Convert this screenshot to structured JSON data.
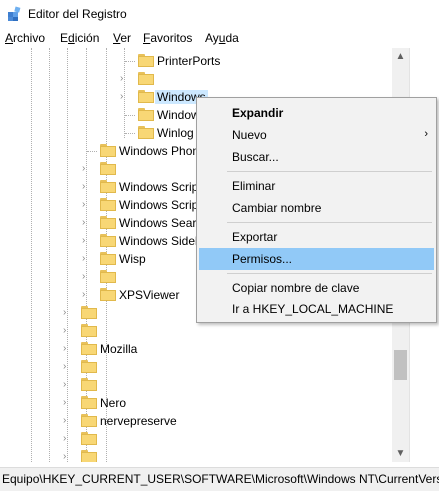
{
  "window": {
    "title": "Editor del Registro"
  },
  "menu": {
    "archivo": {
      "u": "A",
      "rest": "rchivo"
    },
    "edicion": {
      "pre": "E",
      "u": "d",
      "rest": "ición"
    },
    "ver": {
      "u": "V",
      "rest": "er"
    },
    "favoritos": {
      "u": "F",
      "rest": "avoritos"
    },
    "ayuda": {
      "pre": "Ay",
      "u": "u",
      "rest": "da"
    }
  },
  "tree": {
    "printerports": "PrinterPorts",
    "windows": "Windows",
    "windows2": "Window",
    "winlogon": "Winlog",
    "windows_phone": "Windows Phon",
    "windows_script1": "Windows Scrip",
    "windows_script2": "Windows Scrip",
    "windows_search": "Windows Searc",
    "windows_sidebar": "Windows Sidel",
    "wisp": "Wisp",
    "xpsviewer": "XPSViewer",
    "mozilla": "Mozilla",
    "nero": "Nero",
    "nervepreserve": "nervepreserve"
  },
  "context_menu": {
    "expandir": "Expandir",
    "nuevo": "Nuevo",
    "buscar": "Buscar...",
    "eliminar": "Eliminar",
    "cambiar_nombre": "Cambiar nombre",
    "exportar": "Exportar",
    "permisos": "Permisos...",
    "copiar_nombre": "Copiar nombre de clave",
    "ir_a": "Ir a HKEY_LOCAL_MACHINE"
  },
  "status": {
    "path": "Equipo\\HKEY_CURRENT_USER\\SOFTWARE\\Microsoft\\Windows NT\\CurrentVersion\\Windows"
  },
  "icons": {
    "app": "registry-editor-icon",
    "folder": "folder-icon",
    "chevron": "chevron-right-icon",
    "submenu": "submenu-arrow-icon"
  },
  "colors": {
    "selection": "#cce8ff",
    "menu_hover": "#91c9f7",
    "folder": "#f8d775"
  }
}
